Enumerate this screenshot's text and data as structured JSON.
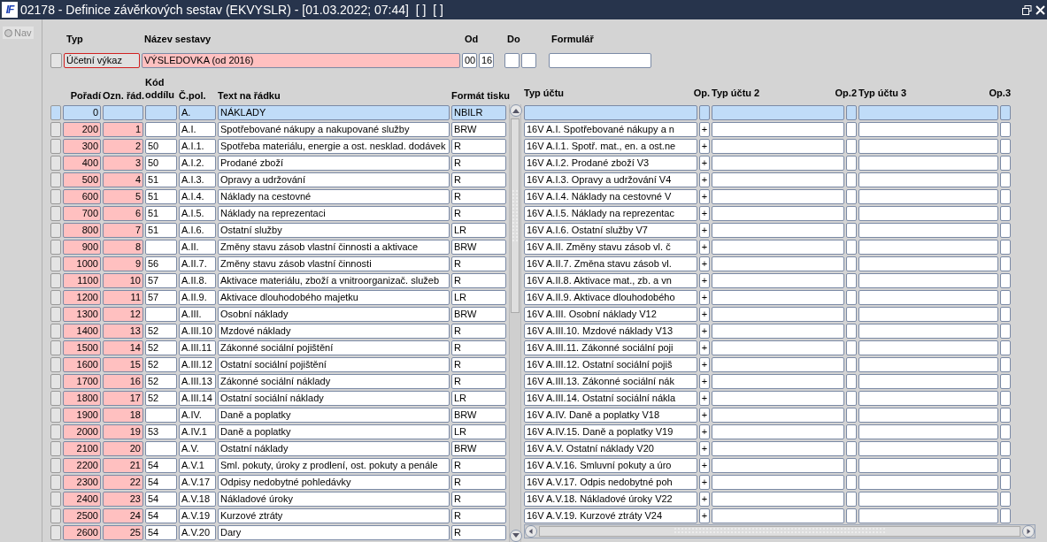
{
  "window": {
    "logo_text": "IF",
    "title": "02178 - Definice závěrkových sestav (EKVYSLR) - [01.03.2022; 07:44]  [ ]  [ ]"
  },
  "nav": {
    "label": "Nav",
    "selected": false
  },
  "header": {
    "typ": {
      "label": "Typ",
      "value": "Účetní výkaz"
    },
    "nazev": {
      "label": "Název sestavy",
      "value": "VÝSLEDOVKA (od 2016)"
    },
    "od": {
      "label": "Od",
      "values": [
        "00",
        "16"
      ]
    },
    "do": {
      "label": "Do"
    },
    "formular": {
      "label": "Formulář"
    }
  },
  "table": {
    "columns": {
      "poradi": "Pořadí",
      "ozn": "Ozn. řád.",
      "kod": "Kód oddílu",
      "cpol": "Č.pol.",
      "text": "Text na řádku",
      "format": "Formát tisku",
      "typ_uctu": "Typ účtu",
      "op": "Op.",
      "typ_uctu_2": "Typ účtu 2",
      "op2": "Op.2",
      "typ_uctu_3": "Typ účtu 3",
      "op3": "Op.3"
    },
    "rows": [
      {
        "selected": true,
        "poradi": "0",
        "cpol": "A.",
        "text": "NÁKLADY",
        "format": "NBILR"
      },
      {
        "selected": false,
        "poradi": "200",
        "ozn": "1",
        "cpol": "A.I.",
        "text": "Spotřebované nákupy a nakupované služby",
        "format": "BRW",
        "typ_uctu": "16V A.I. Spotřebované nákupy a n",
        "op": "+"
      },
      {
        "selected": false,
        "poradi": "300",
        "ozn": "2",
        "kod": "50",
        "cpol": "A.I.1.",
        "text": "Spotřeba materiálu, energie a ost. nesklad. dodávek",
        "format": "R",
        "typ_uctu": "16V A.I.1. Spotř. mat., en. a ost.ne",
        "op": "+"
      },
      {
        "selected": false,
        "poradi": "400",
        "ozn": "3",
        "kod": "50",
        "cpol": "A.I.2.",
        "text": "Prodané zboží",
        "format": "R",
        "typ_uctu": "16V A.I.2. Prodané zboží V3",
        "op": "+"
      },
      {
        "selected": false,
        "poradi": "500",
        "ozn": "4",
        "kod": "51",
        "cpol": "A.I.3.",
        "text": "Opravy a udržování",
        "format": "R",
        "typ_uctu": "16V A.I.3. Opravy a udržování V4",
        "op": "+"
      },
      {
        "selected": false,
        "poradi": "600",
        "ozn": "5",
        "kod": "51",
        "cpol": "A.I.4.",
        "text": "Náklady na cestovné",
        "format": "R",
        "typ_uctu": "16V A.I.4. Náklady na cestovné V",
        "op": "+"
      },
      {
        "selected": false,
        "poradi": "700",
        "ozn": "6",
        "kod": "51",
        "cpol": "A.I.5.",
        "text": "Náklady na reprezentaci",
        "format": "R",
        "typ_uctu": "16V A.I.5. Náklady na reprezentac",
        "op": "+"
      },
      {
        "selected": false,
        "poradi": "800",
        "ozn": "7",
        "kod": "51",
        "cpol": "A.I.6.",
        "text": "Ostatní služby",
        "format": "LR",
        "typ_uctu": "16V A.I.6. Ostatní služby V7",
        "op": "+"
      },
      {
        "selected": false,
        "poradi": "900",
        "ozn": "8",
        "cpol": "A.II.",
        "text": "Změny stavu zásob vlastní činnosti a aktivace",
        "format": "BRW",
        "typ_uctu": "16V A.II. Změny stavu zásob vl. č",
        "op": "+"
      },
      {
        "selected": false,
        "poradi": "1000",
        "ozn": "9",
        "kod": "56",
        "cpol": "A.II.7.",
        "text": "Změny stavu zásob vlastní činnosti",
        "format": "R",
        "typ_uctu": "16V A.II.7. Změna stavu zásob vl.",
        "op": "+"
      },
      {
        "selected": false,
        "poradi": "1100",
        "ozn": "10",
        "kod": "57",
        "cpol": "A.II.8.",
        "text": "Aktivace materiálu, zboží a vnitroorganizač. služeb",
        "format": "R",
        "typ_uctu": "16V A.II.8. Aktivace mat., zb. a vn",
        "op": "+"
      },
      {
        "selected": false,
        "poradi": "1200",
        "ozn": "11",
        "kod": "57",
        "cpol": "A.II.9.",
        "text": "Aktivace dlouhodobého majetku",
        "format": "LR",
        "typ_uctu": "16V A.II.9. Aktivace dlouhodobého",
        "op": "+"
      },
      {
        "selected": false,
        "poradi": "1300",
        "ozn": "12",
        "cpol": "A.III.",
        "text": "Osobní náklady",
        "format": "BRW",
        "typ_uctu": "16V A.III. Osobní náklady V12",
        "op": "+"
      },
      {
        "selected": false,
        "poradi": "1400",
        "ozn": "13",
        "kod": "52",
        "cpol": "A.III.10",
        "text": "Mzdové náklady",
        "format": "R",
        "typ_uctu": "16V A.III.10. Mzdové náklady V13",
        "op": "+"
      },
      {
        "selected": false,
        "poradi": "1500",
        "ozn": "14",
        "kod": "52",
        "cpol": "A.III.11",
        "text": "Zákonné sociální pojištění",
        "format": "R",
        "typ_uctu": "16V A.III.11. Zákonné sociální poji",
        "op": "+"
      },
      {
        "selected": false,
        "poradi": "1600",
        "ozn": "15",
        "kod": "52",
        "cpol": "A.III.12",
        "text": "Ostatní sociální pojištění",
        "format": "R",
        "typ_uctu": "16V A.III.12. Ostatní sociální pojiš",
        "op": "+"
      },
      {
        "selected": false,
        "poradi": "1700",
        "ozn": "16",
        "kod": "52",
        "cpol": "A.III.13",
        "text": "Zákonné sociální náklady",
        "format": "R",
        "typ_uctu": "16V A.III.13. Zákonné sociální nák",
        "op": "+"
      },
      {
        "selected": false,
        "poradi": "1800",
        "ozn": "17",
        "kod": "52",
        "cpol": "A.III.14",
        "text": "Ostatní sociální náklady",
        "format": "LR",
        "typ_uctu": "16V A.III.14. Ostatní sociální nákla",
        "op": "+"
      },
      {
        "selected": false,
        "poradi": "1900",
        "ozn": "18",
        "cpol": "A.IV.",
        "text": "Daně a poplatky",
        "format": "BRW",
        "typ_uctu": "16V A.IV. Daně a poplatky V18",
        "op": "+"
      },
      {
        "selected": false,
        "poradi": "2000",
        "ozn": "19",
        "kod": "53",
        "cpol": "A.IV.1",
        "text": "Daně a poplatky",
        "format": "LR",
        "typ_uctu": "16V A.IV.15. Daně a poplatky V19",
        "op": "+"
      },
      {
        "selected": false,
        "poradi": "2100",
        "ozn": "20",
        "cpol": "A.V.",
        "text": "Ostatní náklady",
        "format": "BRW",
        "typ_uctu": "16V A.V. Ostatní náklady V20",
        "op": "+"
      },
      {
        "selected": false,
        "poradi": "2200",
        "ozn": "21",
        "kod": "54",
        "cpol": "A.V.1",
        "text": "Sml. pokuty, úroky z prodlení, ost. pokuty a penále",
        "format": "R",
        "typ_uctu": "16V A.V.16. Smluvní pokuty a úro",
        "op": "+"
      },
      {
        "selected": false,
        "poradi": "2300",
        "ozn": "22",
        "kod": "54",
        "cpol": "A.V.17",
        "text": "Odpisy nedobytné pohledávky",
        "format": "R",
        "typ_uctu": "16V A.V.17. Odpis nedobytné poh",
        "op": "+"
      },
      {
        "selected": false,
        "poradi": "2400",
        "ozn": "23",
        "kod": "54",
        "cpol": "A.V.18",
        "text": "Nákladové úroky",
        "format": "R",
        "typ_uctu": "16V A.V.18. Nákladové úroky V22",
        "op": "+"
      },
      {
        "selected": false,
        "poradi": "2500",
        "ozn": "24",
        "kod": "54",
        "cpol": "A.V.19",
        "text": "Kurzové ztráty",
        "format": "R",
        "typ_uctu": "16V A.V.19. Kurzové ztráty V24",
        "op": "+"
      },
      {
        "selected": false,
        "poradi": "2600",
        "ozn": "25",
        "kod": "54",
        "cpol": "A.V.20",
        "text": "Dary",
        "format": "R"
      }
    ]
  }
}
